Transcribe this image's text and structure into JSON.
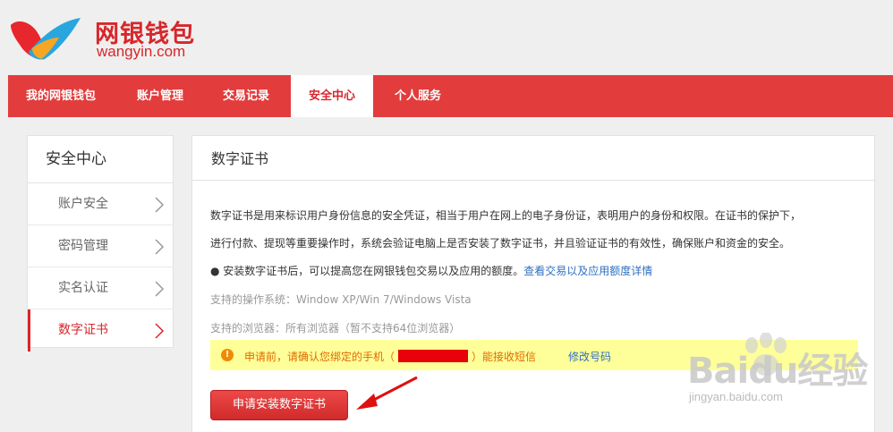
{
  "header": {
    "logo_cn": "网银钱包",
    "logo_en": "wangyin.com",
    "brand_colors": [
      "#e8262d",
      "#2aa6de",
      "#f6a623"
    ]
  },
  "nav": {
    "items": [
      {
        "label": "我的网银钱包"
      },
      {
        "label": "账户管理"
      },
      {
        "label": "交易记录"
      },
      {
        "label": "安全中心",
        "active": true
      },
      {
        "label": "个人服务"
      }
    ],
    "bg_color": "#e23c3c"
  },
  "sidebar": {
    "title": "安全中心",
    "items": [
      {
        "label": "账户安全"
      },
      {
        "label": "密码管理"
      },
      {
        "label": "实名认证"
      },
      {
        "label": "数字证书",
        "active": true
      }
    ]
  },
  "main": {
    "title": "数字证书",
    "desc_line1": "数字证书是用来标识用户身份信息的安全凭证，相当于用户在网上的电子身份证，表明用户的身份和权限。在证书的保护下，",
    "desc_line2": "进行付款、提现等重要操作时，系统会验证电脑上是否安装了数字证书，并且验证证书的有效性，确保账户和资金的安全。",
    "bullet_text": "● 安装数字证书后，可以提高您在网银钱包交易以及应用的额度。",
    "bullet_link": "查看交易以及应用额度详情",
    "os_support": "支持的操作系统：Window XP/Win 7/Windows Vista",
    "browser_support": "支持的浏览器：所有浏览器（暂不支持64位浏览器）",
    "notice": {
      "icon": "!",
      "text_before": "申请前，请确认您绑定的手机（",
      "text_after": "）能接收短信",
      "link": "修改号码"
    },
    "apply_button": "申请安装数字证书"
  },
  "watermark": {
    "brand": "Baidu经验",
    "url": "jingyan.baidu.com"
  }
}
